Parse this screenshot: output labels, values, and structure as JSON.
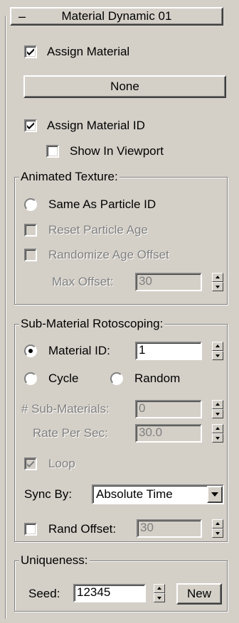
{
  "rollout": {
    "collapse_symbol": "–",
    "title": "Material Dynamic 01"
  },
  "assign_material": {
    "label": "Assign Material",
    "checked": true
  },
  "material_button": {
    "label": "None"
  },
  "assign_material_id": {
    "label": "Assign Material ID",
    "checked": true
  },
  "show_in_viewport": {
    "label": "Show In Viewport",
    "checked": false
  },
  "animated_texture": {
    "title": "Animated Texture:",
    "same_as_particle_id": {
      "label": "Same As Particle ID",
      "selected": false
    },
    "reset_particle_age": {
      "label": "Reset Particle Age",
      "checked": false,
      "enabled": false
    },
    "randomize_age_offset": {
      "label": "Randomize Age Offset",
      "checked": false,
      "enabled": false
    },
    "max_offset": {
      "label": "Max Offset:",
      "value": "30",
      "enabled": false
    }
  },
  "sub_material_rotoscoping": {
    "title": "Sub-Material Rotoscoping:",
    "material_id": {
      "label": "Material ID:",
      "value": "1",
      "selected": true
    },
    "cycle": {
      "label": "Cycle",
      "selected": false
    },
    "random": {
      "label": "Random",
      "selected": false
    },
    "sub_materials": {
      "label": "# Sub-Materials:",
      "value": "0",
      "enabled": false
    },
    "rate_per_sec": {
      "label": "Rate Per Sec:",
      "value": "30.0",
      "enabled": false
    },
    "loop": {
      "label": "Loop",
      "checked": true,
      "enabled": false
    },
    "sync_by": {
      "label": "Sync By:",
      "value": "Absolute Time"
    },
    "rand_offset": {
      "label": "Rand Offset:",
      "value": "30",
      "checked": false
    }
  },
  "uniqueness": {
    "title": "Uniqueness:",
    "seed": {
      "label": "Seed:",
      "value": "12345"
    },
    "new_button": {
      "label": "New"
    }
  },
  "colors": {
    "panel_bg": "#d4d0c8",
    "disabled_text": "#808080"
  }
}
